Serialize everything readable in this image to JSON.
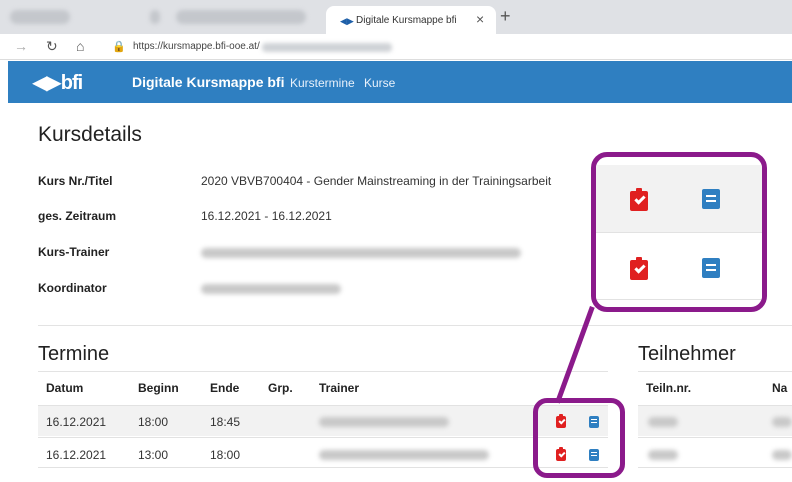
{
  "browser": {
    "active_tab_title": "Digitale Kursmappe bfi",
    "tab_close": "×",
    "new_tab": "+",
    "url": "https://kursmappe.bfi-ooe.at/"
  },
  "header": {
    "logo": "◀▶bfi",
    "app_title": "Digitale Kursmappe bfi",
    "nav": [
      "Kurstermine",
      "Kurse"
    ]
  },
  "page": {
    "title": "Kursdetails",
    "details": [
      {
        "label": "Kurs Nr./Titel",
        "value": "2020 VBVB700404 - Gender Mainstreaming in der Trainingsarbeit"
      },
      {
        "label": "ges. Zeitraum",
        "value": "16.12.2021 - 16.12.2021"
      },
      {
        "label": "Kurs-Trainer",
        "value": ""
      },
      {
        "label": "Koordinator",
        "value": ""
      }
    ]
  },
  "termine": {
    "title": "Termine",
    "columns": [
      "Datum",
      "Beginn",
      "Ende",
      "Grp.",
      "Trainer"
    ],
    "rows": [
      {
        "datum": "16.12.2021",
        "beginn": "18:00",
        "ende": "18:45"
      },
      {
        "datum": "16.12.2021",
        "beginn": "13:00",
        "ende": "18:00"
      }
    ]
  },
  "teilnehmer": {
    "title": "Teilnehmer",
    "columns": [
      "Teiln.nr.",
      "Na"
    ]
  },
  "colors": {
    "header_bg": "#2f7fc1",
    "callout": "#8b1a8b",
    "checklist_icon": "#e02020",
    "book_icon": "#2f7fc1"
  },
  "icons": [
    "clipboard-check-icon",
    "book-icon"
  ]
}
